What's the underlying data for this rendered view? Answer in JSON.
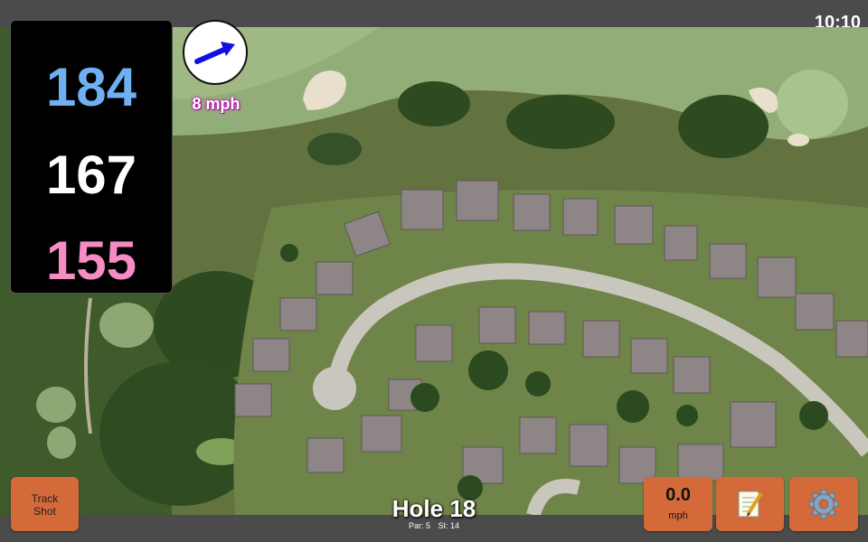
{
  "status": {
    "time": "10:10"
  },
  "distances": {
    "back": "184",
    "middle": "167",
    "front": "155",
    "colors": {
      "back": "#6fb0f2",
      "middle": "#ffffff",
      "front": "#f58cc4"
    }
  },
  "wind": {
    "speed_label": "8 mph",
    "direction_icon": "arrow-right-icon",
    "arrow_color": "#1010e0"
  },
  "buttons": {
    "track_shot": {
      "line1": "Track",
      "line2": "Shot"
    },
    "speed": {
      "value": "0.0",
      "unit": "mph"
    },
    "notes_icon": "notepad-icon",
    "settings_icon": "gear-icon",
    "color": "#d46a3a"
  },
  "hole": {
    "title": "Hole 18",
    "par": "Par: 5",
    "si": "SI: 14"
  }
}
